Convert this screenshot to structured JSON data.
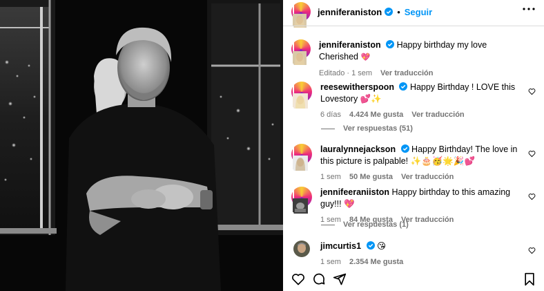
{
  "header": {
    "username": "jenniferaniston",
    "separator": "•",
    "follow_label": "Seguir"
  },
  "caption": {
    "username": "jenniferaniston",
    "line1": "Happy birthday my love",
    "line2": "Cherished",
    "line2_emoji": "💖",
    "edited": "Editado · 1 sem",
    "translate": "Ver traducción"
  },
  "comments": [
    {
      "username": "reesewitherspoon",
      "text": "Happy Birthday ! LOVE this Lovestory 💕✨",
      "time": "6 días",
      "likes": "4.424 Me gusta",
      "translate": "Ver traducción",
      "replies": "Ver respuestas (51)"
    },
    {
      "username": "lauralynnejackson",
      "text": "Happy Birthday! The love in this picture is palpable! ✨🎂🥳🌟🎉💕",
      "time": "1 sem",
      "likes": "50 Me gusta",
      "translate": "Ver traducción"
    },
    {
      "username": "jennifeeraniiston",
      "text": "Happy birthday to this amazing guy!!! 💖",
      "time": "1 sem",
      "likes": "84 Me gusta",
      "translate": "Ver traducción",
      "replies": "Ver respuestas (1)"
    },
    {
      "username": "jimcurtis1",
      "text": "😘",
      "time": "1 sem",
      "likes": "2.354 Me gusta"
    }
  ],
  "icons": {
    "verified": "verified-badge-icon",
    "more": "more-options-icon",
    "like": "heart-icon",
    "comment": "comment-icon",
    "share": "share-icon",
    "save": "bookmark-icon"
  },
  "colors": {
    "accent": "#0095f6",
    "muted": "#737373",
    "divider": "#dbdbdb",
    "heart": "#ff3040"
  }
}
